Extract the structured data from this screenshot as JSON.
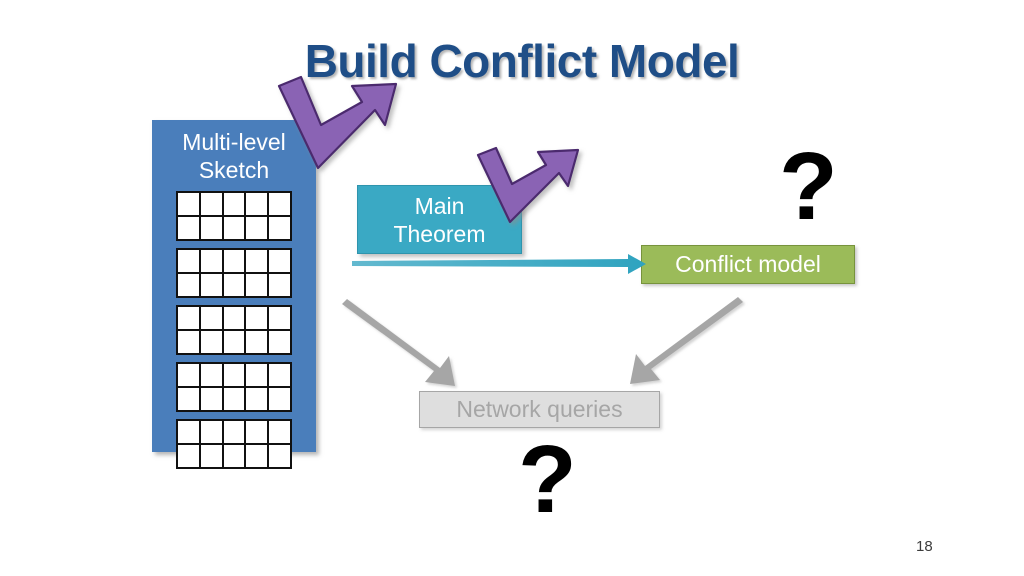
{
  "slide": {
    "title": "Build Conflict Model",
    "page_number": "18",
    "background_color": "#ffffff",
    "title_color": "#1f4e87"
  },
  "sketch_panel": {
    "label_line1": "Multi-level",
    "label_line2": "Sketch",
    "fill_color": "#4a7ebb",
    "text_color": "#ffffff",
    "grid_blocks": 5,
    "grid_columns": 5,
    "grid_rows": 2,
    "cell_fill": "#ffffff",
    "cell_border": "#111111"
  },
  "boxes": {
    "main_theorem": {
      "label_line1": "Main",
      "label_line2": "Theorem",
      "fill_color": "#3aa9c4",
      "text_color": "#ffffff"
    },
    "conflict_model": {
      "label": "Conflict model",
      "fill_color": "#9bbb59",
      "border_color": "#77933c",
      "text_color": "#ffffff"
    },
    "network_queries": {
      "label": "Network queries",
      "fill_color": "#dedede",
      "border_color": "#a6a6a6",
      "text_color": "#a6a6a6"
    }
  },
  "annotations": {
    "question_mark_right": "?",
    "question_mark_bottom": "?"
  },
  "arrows": {
    "purple_large": {
      "name": "purple-bent-arrow-large",
      "color": "#8a64b4",
      "outline": "#4b2a6e",
      "direction": "up-right"
    },
    "purple_small": {
      "name": "purple-bent-arrow-small",
      "color": "#8a64b4",
      "outline": "#4b2a6e",
      "direction": "up-right"
    },
    "teal_horizontal": {
      "name": "teal-arrow-to-conflict-model",
      "color": "#3aa9c4",
      "direction": "right"
    },
    "gray_left": {
      "name": "gray-arrow-sketch-to-network-queries",
      "color": "#a6a6a6",
      "direction": "down-right"
    },
    "gray_right": {
      "name": "gray-arrow-conflict-model-to-network-queries",
      "color": "#a6a6a6",
      "direction": "down-left"
    }
  }
}
